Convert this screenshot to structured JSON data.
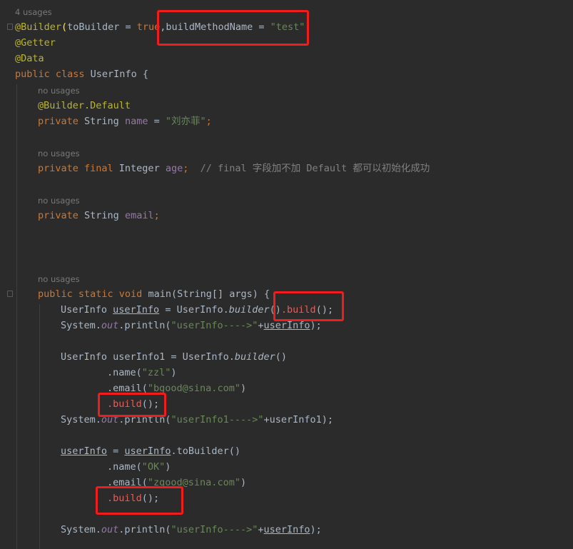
{
  "hints": {
    "class_usages": "4 usages",
    "name_usages": "no usages",
    "age_usages": "no usages",
    "email_usages": "no usages",
    "main_usages": "no usages"
  },
  "code": {
    "l1_at": "@Builder",
    "l1_open": "(",
    "l1_a": "toBuilder = ",
    "l1_true": "true",
    "l1_b": ",buildMethodName = ",
    "l1_str": "\"test\"",
    "l1_close": ")",
    "l2": "@Getter",
    "l3": "@Data",
    "l4_kw": "public class ",
    "l4_rest": "UserInfo {",
    "l5": "@Builder.Default",
    "l6_kw": "private ",
    "l6_type": "String ",
    "l6_fld": "name",
    "l6_eq": " = ",
    "l6_str": "\"刘亦菲\"",
    "l6_semi": ";",
    "l7_kw": "private final ",
    "l7_type": "Integer ",
    "l7_fld": "age",
    "l7_semi": ";  ",
    "l7_cmt": "// final 字段加不加 Default 都可以初始化成功",
    "l8_kw": "private ",
    "l8_type": "String ",
    "l8_fld": "email",
    "l8_semi": ";",
    "l9_kw": "public static void ",
    "l9_rest": "main(String[] args) {",
    "l10_a": "UserInfo ",
    "l10_var": "userInfo",
    "l10_b": " = UserInfo.",
    "l10_it": "builder",
    "l10_c": "()",
    "l10_build": ".build",
    "l10_d": "();",
    "l11_a": "System.",
    "l11_out": "out",
    "l11_b": ".println(",
    "l11_str": "\"userInfo---->\"",
    "l11_c": "+",
    "l11_var": "userInfo",
    "l11_d": ");",
    "l12_a": "UserInfo userInfo1 = UserInfo.",
    "l12_it": "builder",
    "l12_b": "()",
    "l13_a": ".name(",
    "l13_str": "\"zzl\"",
    "l13_b": ")",
    "l14_a": ".email(",
    "l14_str": "\"bgood@sina.com\"",
    "l14_b": ")",
    "l15_build": ".build",
    "l15_b": "();",
    "l16_a": "System.",
    "l16_out": "out",
    "l16_b": ".println(",
    "l16_str": "\"userInfo1---->\"",
    "l16_c": "+userInfo1);",
    "l17_var": "userInfo",
    "l17_a": " = ",
    "l17_var2": "userInfo",
    "l17_b": ".toBuilder()",
    "l18_a": ".name(",
    "l18_str": "\"OK\"",
    "l18_b": ")",
    "l19_a": ".email(",
    "l19_str": "\"zgood@sina.com\"",
    "l19_b": ")",
    "l20_build": ".build",
    "l20_b": "();",
    "l21_a": "System.",
    "l21_out": "out",
    "l21_b": ".println(",
    "l21_str": "\"userInfo---->\"",
    "l21_c": "+",
    "l21_var": "userInfo",
    "l21_d": ");"
  },
  "colors": {
    "background": "#2b2b2b",
    "keyword": "#cc7832",
    "annotation": "#bbb529",
    "string": "#6a8759",
    "field": "#9876aa",
    "comment": "#808080",
    "highlight_box": "#ef1d1d"
  }
}
